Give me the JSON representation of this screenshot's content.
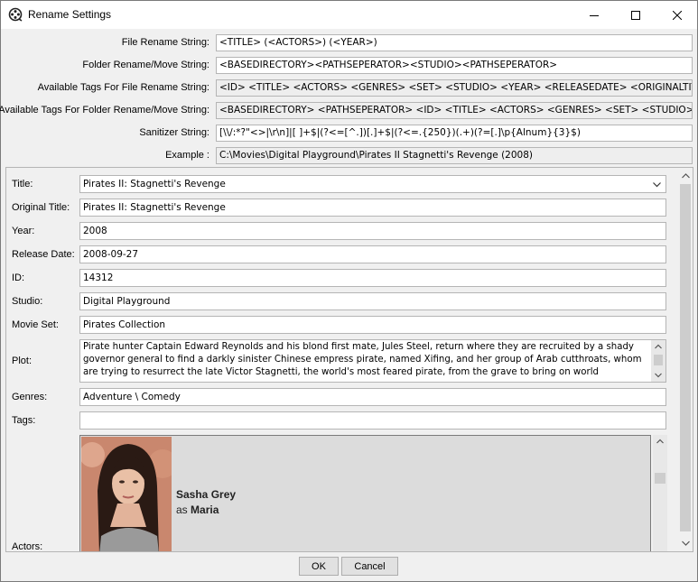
{
  "window": {
    "title": "Rename Settings"
  },
  "settings": {
    "file_rename": {
      "label": "File Rename String:",
      "value": "<TITLE> (<ACTORS>) (<YEAR>)"
    },
    "folder_rename": {
      "label": "Folder Rename/Move String:",
      "value": "<BASEDIRECTORY><PATHSEPERATOR><STUDIO><PATHSEPERATOR>"
    },
    "file_tags": {
      "label": "Available Tags For File Rename String:",
      "value": "<ID> <TITLE> <ACTORS> <GENRES> <SET> <STUDIO> <YEAR> <RELEASEDATE> <ORIGINALTITLE>"
    },
    "folder_tags": {
      "label": "Available Tags For Folder Rename/Move String:",
      "value": "<BASEDIRECTORY> <PATHSEPERATOR> <ID> <TITLE> <ACTORS> <GENRES> <SET> <STUDIO> <YEAI"
    },
    "sanitizer": {
      "label": "Sanitizer String:",
      "value": "[\\\\/:*?\"<>|\\r\\n]|[ ]+$|(?<=[^.])[.]+$|(?<=.{250})(.+)(?=[.]\\p{Alnum}{3}$)"
    },
    "example": {
      "label": "Example :",
      "value": "C:\\Movies\\Digital Playground\\Pirates II Stagnetti's Revenge (2008)"
    }
  },
  "movie": {
    "title": {
      "label": "Title:",
      "value": "Pirates II: Stagnetti's Revenge"
    },
    "original_title": {
      "label": "Original Title:",
      "value": "Pirates II: Stagnetti's Revenge"
    },
    "year": {
      "label": "Year:",
      "value": "2008"
    },
    "release_date": {
      "label": "Release Date:",
      "value": "2008-09-27"
    },
    "id": {
      "label": "ID:",
      "value": "14312"
    },
    "studio": {
      "label": "Studio:",
      "value": "Digital Playground"
    },
    "movie_set": {
      "label": "Movie Set:",
      "value": "Pirates Collection"
    },
    "plot": {
      "label": "Plot:",
      "value": "Pirate hunter Captain Edward Reynolds and his blond first mate, Jules Steel, return where they are recruited by a shady governor general to find a darkly sinister Chinese empress pirate, named Xifing, and her group of Arab cutthroats, whom are trying to resurrect the late Victor Stagnetti, the world's most feared pirate, from the grave to bring on world domination. When Jules is"
    },
    "genres": {
      "label": "Genres:",
      "value": "Adventure \\ Comedy"
    },
    "tags": {
      "label": "Tags:",
      "value": ""
    },
    "actors": {
      "label": "Actors:",
      "list": [
        {
          "name": "Sasha Grey",
          "as_prefix": "as",
          "role": "Maria"
        }
      ]
    }
  },
  "buttons": {
    "ok": "OK",
    "cancel": "Cancel"
  },
  "icons": {
    "app": "film-reel-icon",
    "minimize": "minimize-icon",
    "maximize": "maximize-icon",
    "close": "close-icon",
    "combo": "chevron-down-icon"
  }
}
